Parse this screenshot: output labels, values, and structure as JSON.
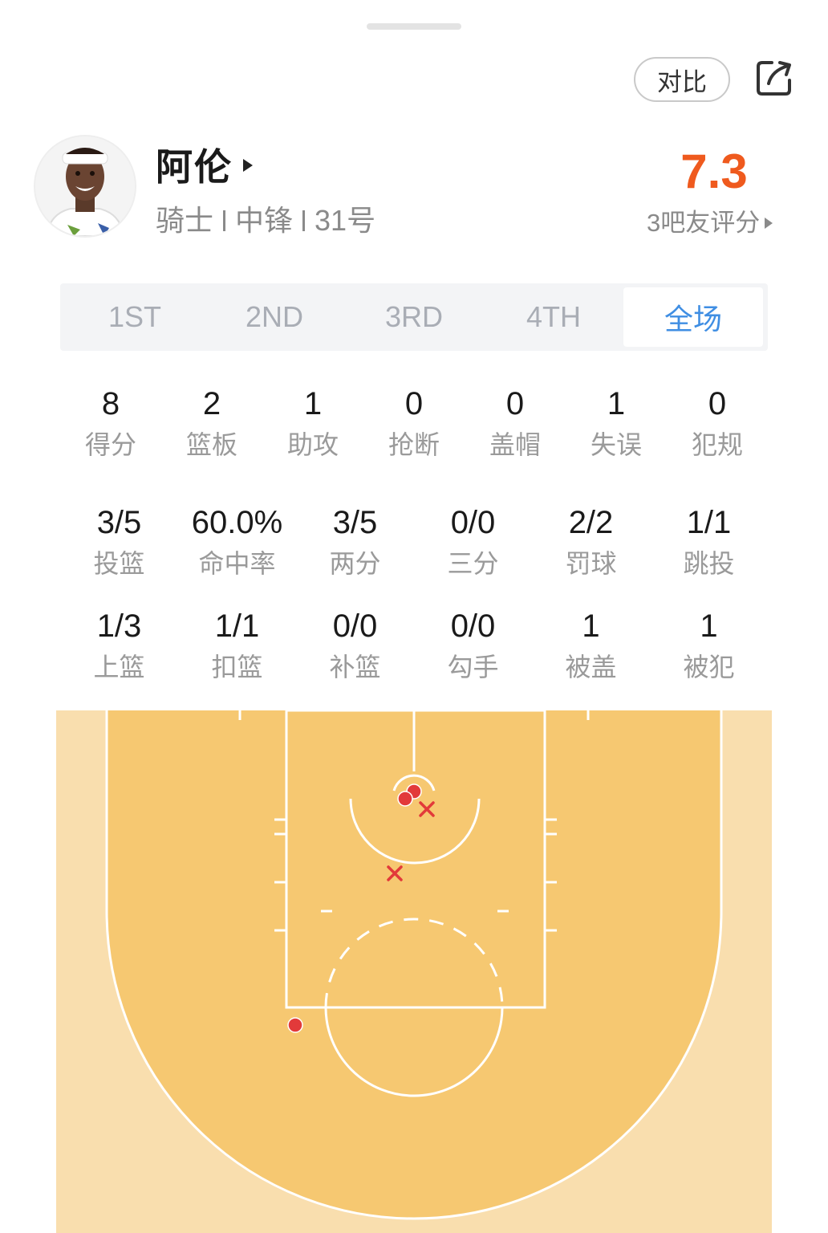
{
  "header": {
    "compare_label": "对比",
    "share_icon": "share-icon"
  },
  "player": {
    "name": "阿伦",
    "team": "骑士",
    "position": "中锋",
    "number": "31号",
    "rating": "7.3",
    "rating_label": "3吧友评分"
  },
  "periods": {
    "tabs": [
      "1ST",
      "2ND",
      "3RD",
      "4TH",
      "全场"
    ],
    "selected": "全场"
  },
  "stats_main": [
    {
      "value": "8",
      "label": "得分"
    },
    {
      "value": "2",
      "label": "篮板"
    },
    {
      "value": "1",
      "label": "助攻"
    },
    {
      "value": "0",
      "label": "抢断"
    },
    {
      "value": "0",
      "label": "盖帽"
    },
    {
      "value": "1",
      "label": "失误"
    },
    {
      "value": "0",
      "label": "犯规"
    }
  ],
  "stats_shooting": [
    {
      "value": "3/5",
      "label": "投篮"
    },
    {
      "value": "60.0%",
      "label": "命中率"
    },
    {
      "value": "3/5",
      "label": "两分"
    },
    {
      "value": "0/0",
      "label": "三分"
    },
    {
      "value": "2/2",
      "label": "罚球"
    },
    {
      "value": "1/1",
      "label": "跳投"
    }
  ],
  "stats_shot_types": [
    {
      "value": "1/3",
      "label": "上篮"
    },
    {
      "value": "1/1",
      "label": "扣篮"
    },
    {
      "value": "0/0",
      "label": "补篮"
    },
    {
      "value": "0/0",
      "label": "勾手"
    },
    {
      "value": "1",
      "label": "被盖"
    },
    {
      "value": "1",
      "label": "被犯"
    }
  ],
  "shot_chart": {
    "made_color": "#e23a3a",
    "missed_color": "#e23a3a",
    "court_color": "#f6c871",
    "outer_color": "#f9deae",
    "shots": [
      {
        "result": "made"
      },
      {
        "result": "made"
      },
      {
        "result": "missed"
      },
      {
        "result": "missed"
      },
      {
        "result": "made"
      }
    ]
  }
}
